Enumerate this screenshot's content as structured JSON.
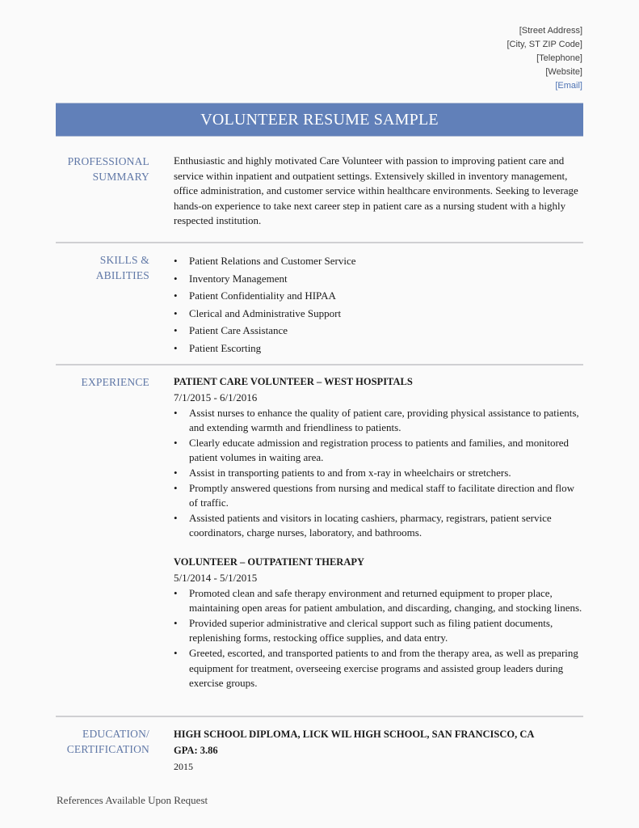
{
  "contact": {
    "street": "[Street Address]",
    "city": "[City, ST ZIP Code]",
    "telephone": "[Telephone]",
    "website": "[Website]",
    "email": "[Email]"
  },
  "title": "VOLUNTEER RESUME SAMPLE",
  "colors": {
    "banner": "#6180b9",
    "section_label": "#5f77a6",
    "email_link": "#4e73b4",
    "divider": "#cfcfd2"
  },
  "summary": {
    "label_line1": "PROFESSIONAL",
    "label_line2": "SUMMARY",
    "text": "Enthusiastic and highly motivated Care Volunteer with passion to improving patient care and service within inpatient and outpatient settings. Extensively skilled in inventory management, office administration, and customer service within healthcare environments. Seeking to leverage hands-on experience to take next career step in patient care as a nursing student with a highly respected institution."
  },
  "skills": {
    "label_line1": "SKILLS &",
    "label_line2": "ABILITIES",
    "bullet": "•",
    "items": [
      "Patient Relations and Customer Service",
      "Inventory Management",
      "Patient Confidentiality and HIPAA",
      "Clerical and Administrative Support",
      "Patient Care Assistance",
      "Patient Escorting"
    ]
  },
  "experience": {
    "label": "EXPERIENCE",
    "jobs": [
      {
        "title": "PATIENT CARE VOLUNTEER – WEST HOSPITALS",
        "dates": "7/1/2015 - 6/1/2016",
        "bullets": [
          "Assist nurses to enhance the quality of patient care, providing physical assistance to patients, and extending warmth and friendliness to patients.",
          "Clearly educate admission and registration process to patients and families, and monitored patient volumes in waiting area.",
          "Assist in transporting patients to and from x-ray in wheelchairs or stretchers.",
          "Promptly answered questions from nursing and medical staff to facilitate direction and flow of traffic.",
          "Assisted patients and visitors in locating cashiers, pharmacy, registrars, patient service coordinators, charge nurses, laboratory, and bathrooms."
        ]
      },
      {
        "title": "VOLUNTEER – OUTPATIENT THERAPY",
        "dates": "5/1/2014 - 5/1/2015",
        "bullets": [
          "Promoted clean and safe therapy environment and returned equipment to proper place, maintaining open areas for patient ambulation, and discarding, changing, and stocking linens.",
          "Provided superior administrative and clerical support such as filing patient documents, replenishing forms, restocking office supplies, and data entry.",
          "Greeted, escorted, and transported patients to and from the therapy area, as well as preparing equipment for treatment, overseeing exercise programs and assisted group leaders during exercise groups."
        ]
      }
    ]
  },
  "education": {
    "label_line1": "EDUCATION/",
    "label_line2": "CERTIFICATION",
    "degree": "HIGH SCHOOL DIPLOMA, LICK WIL HIGH SCHOOL, SAN FRANCISCO, CA",
    "gpa": "GPA: 3.86",
    "year": "2015"
  },
  "footer": "References Available Upon Request"
}
